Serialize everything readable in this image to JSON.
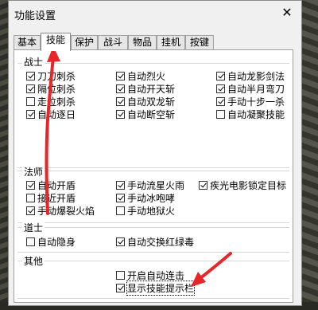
{
  "window": {
    "title": "功能设置",
    "close_glyph": "✕"
  },
  "tabs": [
    {
      "label": "基本",
      "active": false
    },
    {
      "label": "技能",
      "active": true
    },
    {
      "label": "保护",
      "active": false
    },
    {
      "label": "战斗",
      "active": false
    },
    {
      "label": "物品",
      "active": false
    },
    {
      "label": "挂机",
      "active": false
    },
    {
      "label": "按键",
      "active": false
    }
  ],
  "groups": {
    "warrior": {
      "title": "战士",
      "items": [
        {
          "label": "刀刀刺杀",
          "checked": true
        },
        {
          "label": "隔位刺杀",
          "checked": true
        },
        {
          "label": "走位刺杀",
          "checked": false
        },
        {
          "label": "自动逐日",
          "checked": true
        },
        {
          "label": "自动烈火",
          "checked": true
        },
        {
          "label": "自动开天斩",
          "checked": true
        },
        {
          "label": "自动双龙斩",
          "checked": true
        },
        {
          "label": "自动断空斩",
          "checked": true
        },
        {
          "label": "自动龙影剑法",
          "checked": true
        },
        {
          "label": "自动半月弯刀",
          "checked": true
        },
        {
          "label": "手动十步一杀",
          "checked": true
        },
        {
          "label": "自动凝聚技能",
          "checked": false
        }
      ]
    },
    "mage": {
      "title": "法师",
      "items": [
        {
          "label": "自动开盾",
          "checked": true
        },
        {
          "label": "接近开盾",
          "checked": false
        },
        {
          "label": "手动爆裂火焰",
          "checked": true
        },
        {
          "label": "手动流星火雨",
          "checked": true
        },
        {
          "label": "手动冰咆哮",
          "checked": true
        },
        {
          "label": "手动地狱火",
          "checked": false
        },
        {
          "label": "疾光电影锁定目标",
          "checked": true
        }
      ]
    },
    "taoist": {
      "title": "道士",
      "items": [
        {
          "label": "自动隐身",
          "checked": false
        },
        {
          "label": "自动交换红绿毒",
          "checked": true
        }
      ]
    },
    "other": {
      "title": "其他",
      "items": [
        {
          "label": "开启自动连击",
          "checked": false
        },
        {
          "label": "显示技能提示栏",
          "checked": true
        }
      ]
    }
  },
  "colors": {
    "annotation_arrow": "#e8262a"
  }
}
